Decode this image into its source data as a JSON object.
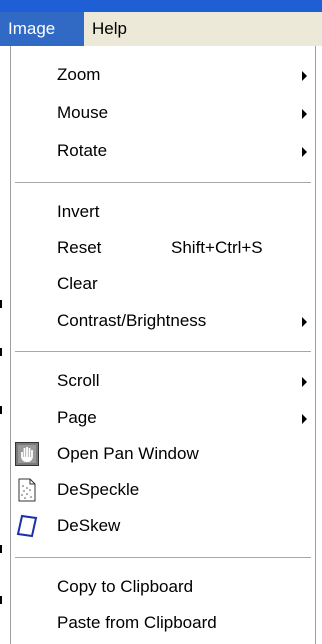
{
  "menubar": {
    "items": [
      {
        "label": "Image",
        "active": true
      },
      {
        "label": "Help",
        "active": false
      }
    ]
  },
  "menu": {
    "items": [
      {
        "label": "Zoom",
        "submenu": true
      },
      {
        "label": "Mouse",
        "submenu": true
      },
      {
        "label": "Rotate",
        "submenu": true
      },
      {
        "label": "Invert"
      },
      {
        "label": "Reset",
        "shortcut": "Shift+Ctrl+S"
      },
      {
        "label": "Clear"
      },
      {
        "label": "Contrast/Brightness",
        "submenu": true
      },
      {
        "label": "Scroll",
        "submenu": true
      },
      {
        "label": "Page",
        "submenu": true
      },
      {
        "label": "Open Pan Window",
        "icon": "hand-pan-icon"
      },
      {
        "label": "DeSpeckle",
        "icon": "despeckle-page-icon"
      },
      {
        "label": "DeSkew",
        "icon": "deskew-page-icon"
      },
      {
        "label": "Copy to Clipboard"
      },
      {
        "label": "Paste from Clipboard"
      }
    ]
  },
  "colors": {
    "title_bar": "#1f5fd6",
    "menubar_bg": "#ece9d8",
    "active_highlight": "#316ac5",
    "menu_bg": "#ffffff"
  }
}
